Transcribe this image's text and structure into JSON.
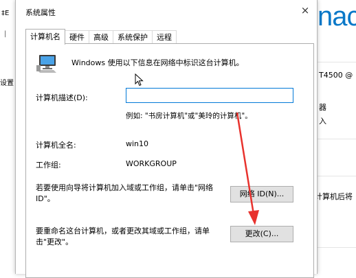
{
  "background": {
    "left_fragment_1": "‡E",
    "left_fragment_2": "|",
    "left_fragment_3": "设置",
    "brand_fragment": "nac",
    "right_fragment_1": "T4500 @",
    "right_fragment_2": "器",
    "right_fragment_3": "入",
    "right_fragment_4": "计算机后将"
  },
  "dialog": {
    "title": "系统属性",
    "close_glyph": "×",
    "tabs": [
      {
        "label": "计算机名",
        "active": true
      },
      {
        "label": "硬件",
        "active": false
      },
      {
        "label": "高级",
        "active": false
      },
      {
        "label": "系统保护",
        "active": false
      },
      {
        "label": "远程",
        "active": false
      }
    ],
    "intro_text": "Windows 使用以下信息在网络中标识这台计算机。",
    "description_label": "计算机描述(D):",
    "description_value": "",
    "example_text": "例如: \"书房计算机\"或\"美玲的计算机\"。",
    "full_name_label": "计算机全名:",
    "full_name_value": "win10",
    "workgroup_label": "工作组:",
    "workgroup_value": "WORKGROUP",
    "network_id_text": "若要使用向导将计算机加入域或工作组，请单击\"网络 ID\"。",
    "network_id_button": "网络 ID(N)...",
    "rename_text": "要重命名这台计算机，或者更改其域或工作组，请单击\"更改\"。",
    "change_button": "更改(C)..."
  },
  "colors": {
    "annotation_arrow": "#e8322d",
    "input_border": "#0078d7",
    "brand": "#0a78c8"
  }
}
